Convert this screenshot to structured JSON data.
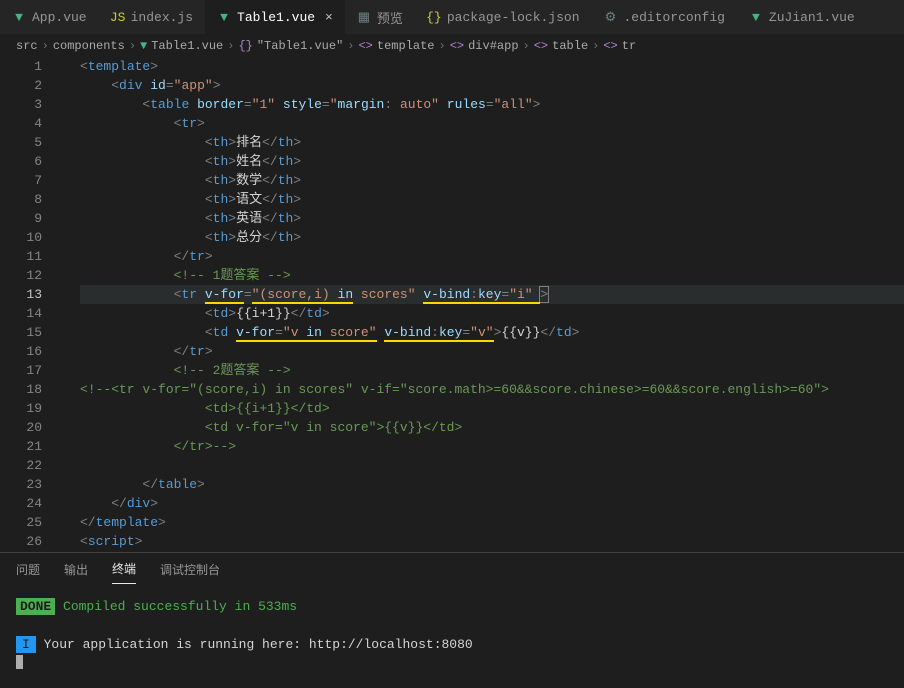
{
  "tabs": [
    {
      "label": "App.vue",
      "iconColor": "vue"
    },
    {
      "label": "index.js",
      "iconColor": "js"
    },
    {
      "label": "Table1.vue",
      "iconColor": "vue",
      "active": true,
      "hasClose": true
    },
    {
      "label": "预览",
      "iconColor": "preview"
    },
    {
      "label": "package-lock.json",
      "iconColor": "json"
    },
    {
      "label": ".editorconfig",
      "iconColor": "config"
    },
    {
      "label": "ZuJian1.vue",
      "iconColor": "vue"
    }
  ],
  "breadcrumbs": [
    {
      "label": "src"
    },
    {
      "label": "components"
    },
    {
      "label": "Table1.vue",
      "icon": "vue"
    },
    {
      "label": "\"Table1.vue\"",
      "icon": "braces"
    },
    {
      "label": "template",
      "icon": "element"
    },
    {
      "label": "div#app",
      "icon": "element"
    },
    {
      "label": "table",
      "icon": "element"
    },
    {
      "label": "tr",
      "icon": "element"
    }
  ],
  "code": {
    "lines": [
      {
        "n": 1,
        "html": "<span class='tag'>&lt;</span><span class='tagname'>template</span><span class='tag'>&gt;</span>"
      },
      {
        "n": 2,
        "html": "    <span class='tag'>&lt;</span><span class='tagname'>div</span> <span class='attr'>id</span><span class='tag'>=</span><span class='attrval'>\"app\"</span><span class='tag'>&gt;</span>"
      },
      {
        "n": 3,
        "html": "        <span class='tag'>&lt;</span><span class='tagname'>table</span> <span class='attr'>border</span><span class='tag'>=</span><span class='attrval'>\"1\"</span> <span class='attr'>style</span><span class='tag'>=</span><span class='attrval'>\"</span><span class='attr'>margin</span><span class='tag'>: </span><span class='attrval'>auto\"</span> <span class='attr'>rules</span><span class='tag'>=</span><span class='attrval'>\"all\"</span><span class='tag'>&gt;</span>"
      },
      {
        "n": 4,
        "html": "            <span class='tag'>&lt;</span><span class='tagname'>tr</span><span class='tag'>&gt;</span>"
      },
      {
        "n": 5,
        "html": "                <span class='tag'>&lt;</span><span class='tagname'>th</span><span class='tag'>&gt;</span><span class='text-content'>排名</span><span class='tag'>&lt;/</span><span class='tagname'>th</span><span class='tag'>&gt;</span>"
      },
      {
        "n": 6,
        "html": "                <span class='tag'>&lt;</span><span class='tagname'>th</span><span class='tag'>&gt;</span><span class='text-content'>姓名</span><span class='tag'>&lt;/</span><span class='tagname'>th</span><span class='tag'>&gt;</span>"
      },
      {
        "n": 7,
        "html": "                <span class='tag'>&lt;</span><span class='tagname'>th</span><span class='tag'>&gt;</span><span class='text-content'>数学</span><span class='tag'>&lt;/</span><span class='tagname'>th</span><span class='tag'>&gt;</span>"
      },
      {
        "n": 8,
        "html": "                <span class='tag'>&lt;</span><span class='tagname'>th</span><span class='tag'>&gt;</span><span class='text-content'>语文</span><span class='tag'>&lt;/</span><span class='tagname'>th</span><span class='tag'>&gt;</span>"
      },
      {
        "n": 9,
        "html": "                <span class='tag'>&lt;</span><span class='tagname'>th</span><span class='tag'>&gt;</span><span class='text-content'>英语</span><span class='tag'>&lt;/</span><span class='tagname'>th</span><span class='tag'>&gt;</span>"
      },
      {
        "n": 10,
        "html": "                <span class='tag'>&lt;</span><span class='tagname'>th</span><span class='tag'>&gt;</span><span class='text-content'>总分</span><span class='tag'>&lt;/</span><span class='tagname'>th</span><span class='tag'>&gt;</span>"
      },
      {
        "n": 11,
        "html": "            <span class='tag'>&lt;/</span><span class='tagname'>tr</span><span class='tag'>&gt;</span>"
      },
      {
        "n": 12,
        "html": "            <span class='comment'>&lt;!-- 1题答案 --&gt;</span>"
      },
      {
        "n": 13,
        "current": true,
        "html": "            <span class='tag'>&lt;</span><span class='tagname'>tr</span> <span class='attr underline-yellow-thick'>v-for</span><span class='tag'>=</span><span class='attrval underline-yellow-thick'>\"(score,i) </span><span class='attr underline-yellow-thick'>in</span><span class='attrval'> scores\"</span> <span class='attr underline-yellow-thick'>v-bind</span><span class='tag underline-yellow-thick'>:</span><span class='attr underline-yellow-thick'>key</span><span class='tag underline-yellow-thick'>=</span><span class='attrval underline-yellow-thick'>\"i\" </span><span class='tag' style='outline:1px solid #7f7f7f'>&gt;</span>"
      },
      {
        "n": 14,
        "html": "                <span class='tag'>&lt;</span><span class='tagname'>td</span><span class='tag'>&gt;</span><span class='text-content'>{{i+1}}</span><span class='tag'>&lt;/</span><span class='tagname'>td</span><span class='tag'>&gt;</span>"
      },
      {
        "n": 15,
        "html": "                <span class='tag'>&lt;</span><span class='tagname'>td</span> <span class='attr underline-yellow-thick'>v-for</span><span class='tag underline-yellow-thick'>=</span><span class='attrval underline-yellow-thick'>\"v </span><span class='attr underline-yellow-thick'>in</span><span class='attrval underline-yellow-thick'> score\"</span> <span class='attr underline-yellow-thick'>v-bind</span><span class='tag underline-yellow-thick'>:</span><span class='attr underline-yellow-thick'>key</span><span class='tag underline-yellow-thick'>=</span><span class='attrval underline-yellow-thick'>\"v\"</span><span class='tag'>&gt;</span><span class='text-content'>{{v}}</span><span class='tag'>&lt;/</span><span class='tagname'>td</span><span class='tag'>&gt;</span>"
      },
      {
        "n": 16,
        "html": "            <span class='tag'>&lt;/</span><span class='tagname'>tr</span><span class='tag'>&gt;</span>"
      },
      {
        "n": 17,
        "html": "            <span class='comment'>&lt;!-- 2题答案 --&gt;</span>"
      },
      {
        "n": 18,
        "html": "<span class='comment'>&lt;!--&lt;tr v-for=\"(score,i) in scores\" v-if=\"score.math&gt;=60&amp;&amp;score.chinese&gt;=60&amp;&amp;score.english&gt;=60\"&gt;</span>"
      },
      {
        "n": 19,
        "html": "                <span class='comment'>&lt;td&gt;{{i+1}}&lt;/td&gt;</span>"
      },
      {
        "n": 20,
        "html": "                <span class='comment'>&lt;td v-for=\"v in score\"&gt;{{v}}&lt;/td&gt;</span>"
      },
      {
        "n": 21,
        "html": "            <span class='comment'>&lt;/tr&gt;--&gt;</span>"
      },
      {
        "n": 22,
        "html": ""
      },
      {
        "n": 23,
        "html": "        <span class='tag'>&lt;/</span><span class='tagname'>table</span><span class='tag'>&gt;</span>"
      },
      {
        "n": 24,
        "html": "    <span class='tag'>&lt;/</span><span class='tagname'>div</span><span class='tag'>&gt;</span>"
      },
      {
        "n": 25,
        "html": "<span class='tag'>&lt;/</span><span class='tagname'>template</span><span class='tag'>&gt;</span>"
      },
      {
        "n": 26,
        "html": "<span class='tag'>&lt;</span><span class='tagname'>script</span><span class='tag'>&gt;</span>"
      }
    ]
  },
  "panel": {
    "tabs": [
      "问题",
      "输出",
      "终端",
      "调试控制台"
    ],
    "activeTab": "终端",
    "terminal": {
      "doneLabel": "DONE",
      "doneMsg": "Compiled successfully in 533ms",
      "infoLabel": "I",
      "infoMsg": "Your application is running here: http://localhost:8080"
    }
  }
}
